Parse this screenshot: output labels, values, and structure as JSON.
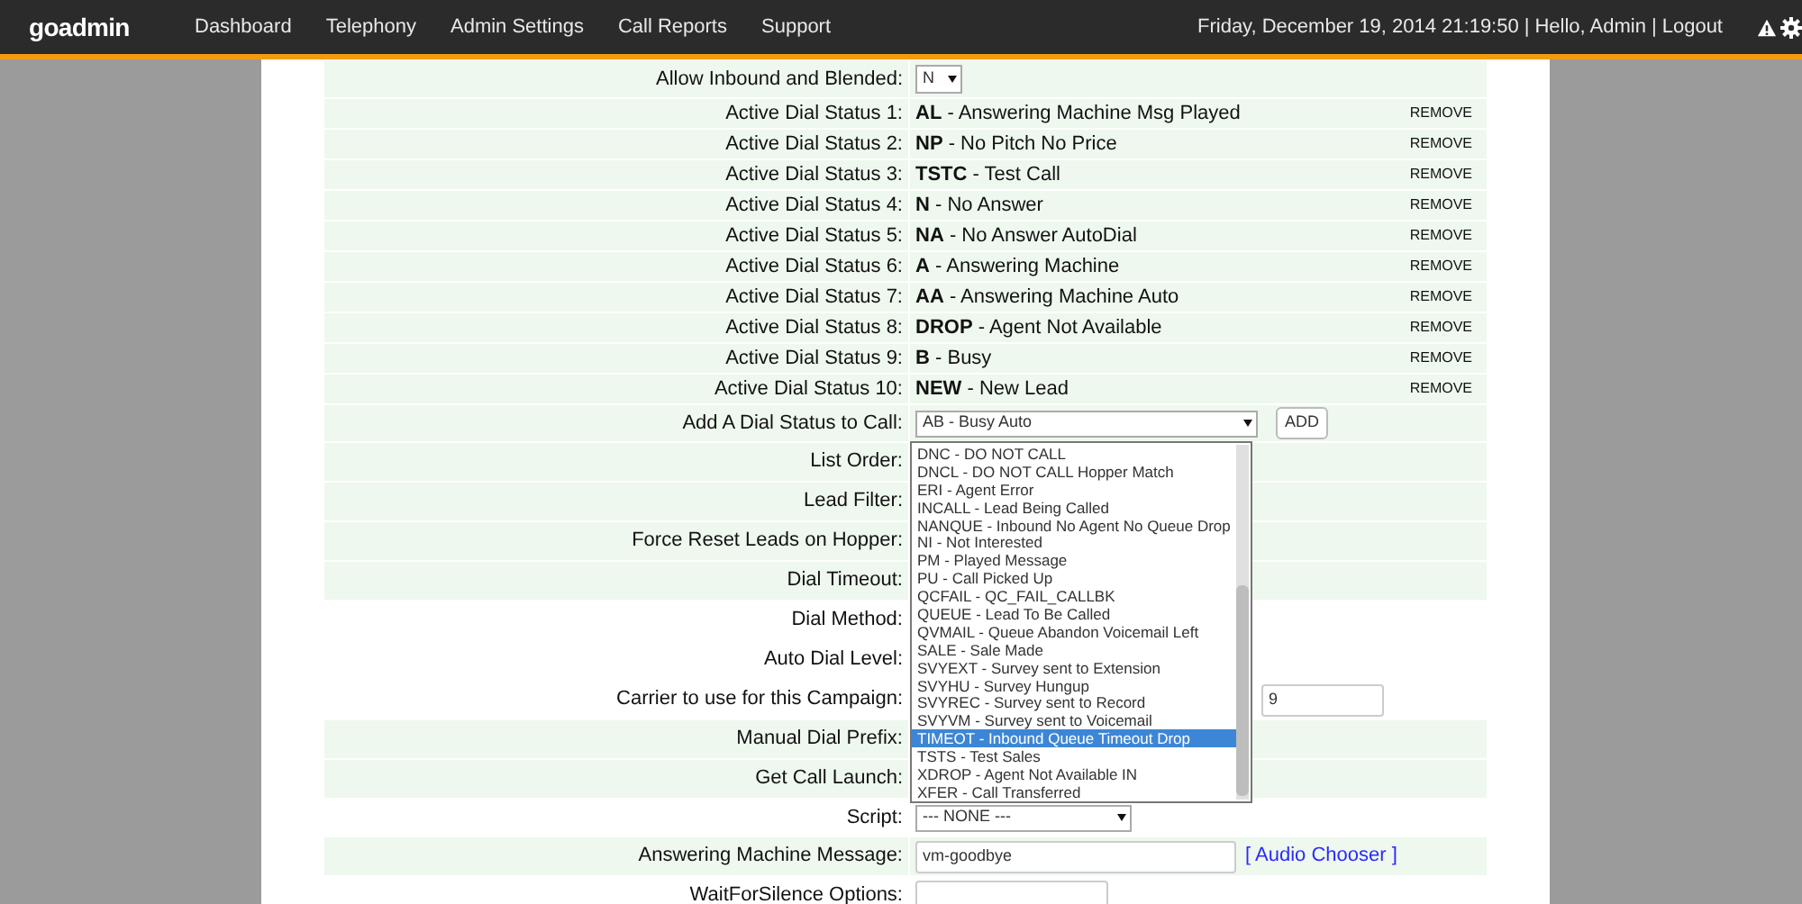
{
  "nav": {
    "logo": "goadmin",
    "menu": [
      "Dashboard",
      "Telephony",
      "Admin Settings",
      "Call Reports",
      "Support"
    ],
    "datetime": "Friday, December 19, 2014 21:19:50",
    "separator_1": "|",
    "greeting": "Hello, Admin",
    "separator_2": "|",
    "logout": "Logout"
  },
  "form": {
    "rows": [
      {
        "kind": "select",
        "label": "Allow Inbound and Blended:",
        "value": "N",
        "shaded": true
      },
      {
        "kind": "status",
        "label": "Active Dial Status 1:",
        "status": "**AL** - Answering Machine Msg Played",
        "action": "REMOVE",
        "shaded": true
      },
      {
        "kind": "status",
        "label": "Active Dial Status 2:",
        "status": "**NP** - No Pitch No Price",
        "action": "REMOVE",
        "shaded": true
      },
      {
        "kind": "status",
        "label": "Active Dial Status 3:",
        "status": "**TSTC** - Test Call",
        "action": "REMOVE",
        "shaded": true
      },
      {
        "kind": "status",
        "label": "Active Dial Status 4:",
        "status": "**N** - No Answer",
        "action": "REMOVE",
        "shaded": true
      },
      {
        "kind": "status",
        "label": "Active Dial Status 5:",
        "status": "**NA** - No Answer AutoDial",
        "action": "REMOVE",
        "shaded": true
      },
      {
        "kind": "status",
        "label": "Active Dial Status 6:",
        "status": "**A** - Answering Machine",
        "action": "REMOVE",
        "shaded": true
      },
      {
        "kind": "status",
        "label": "Active Dial Status 7:",
        "status": "**AA** - Answering Machine Auto",
        "action": "REMOVE",
        "shaded": true
      },
      {
        "kind": "status",
        "label": "Active Dial Status 8:",
        "status": "**DROP** - Agent Not Available",
        "action": "REMOVE",
        "shaded": true
      },
      {
        "kind": "status",
        "label": "Active Dial Status 9:",
        "status": "**B** - Busy",
        "action": "REMOVE",
        "shaded": true
      },
      {
        "kind": "status",
        "label": "Active Dial Status 10:",
        "status": "**NEW** - New Lead",
        "action": "REMOVE",
        "shaded": true
      },
      {
        "kind": "add",
        "label": "Add A Dial Status to Call:",
        "value": "AB - Busy Auto",
        "button": "ADD",
        "shaded": true
      },
      {
        "kind": "blank",
        "label": "List Order:",
        "shaded": true
      },
      {
        "kind": "blank",
        "label": "Lead Filter:",
        "shaded": true
      },
      {
        "kind": "blank",
        "label": "Force Reset Leads on Hopper:",
        "shaded": true
      },
      {
        "kind": "blank",
        "label": "Dial Timeout:",
        "shaded": true
      },
      {
        "kind": "blank",
        "label": "Dial Method:",
        "shaded": false
      },
      {
        "kind": "blank",
        "label": "Auto Dial Level:",
        "shaded": false
      },
      {
        "kind": "carrier",
        "label": "Carrier to use for this Campaign:",
        "value": "9",
        "shaded": false
      },
      {
        "kind": "blank",
        "label": "Manual Dial Prefix:",
        "shaded": true
      },
      {
        "kind": "blank",
        "label": "Get Call Launch:",
        "shaded": true
      },
      {
        "kind": "select",
        "label": "Script:",
        "value": "--- NONE ---",
        "shaded": false
      },
      {
        "kind": "input_link",
        "label": "Answering Machine Message:",
        "value": "vm-goodbye",
        "link": "[ Audio Chooser ]",
        "shaded": true
      },
      {
        "kind": "input",
        "label": "WaitForSilence Options:",
        "shaded": false
      }
    ]
  },
  "dropdown": {
    "options": [
      {
        "label": "DNC - DO NOT CALL",
        "selected": false
      },
      {
        "label": "DNCL - DO NOT CALL Hopper Match",
        "selected": false
      },
      {
        "label": "ERI - Agent Error",
        "selected": false
      },
      {
        "label": "INCALL - Lead Being Called",
        "selected": false
      },
      {
        "label": "NANQUE - Inbound No Agent No Queue Drop",
        "selected": false
      },
      {
        "label": "NI - Not Interested",
        "selected": false
      },
      {
        "label": "PM - Played Message",
        "selected": false
      },
      {
        "label": "PU - Call Picked Up",
        "selected": false
      },
      {
        "label": "QCFAIL - QC_FAIL_CALLBK",
        "selected": false
      },
      {
        "label": "QUEUE - Lead To Be Called",
        "selected": false
      },
      {
        "label": "QVMAIL - Queue Abandon Voicemail Left",
        "selected": false
      },
      {
        "label": "SALE - Sale Made",
        "selected": false
      },
      {
        "label": "SVYEXT - Survey sent to Extension",
        "selected": false
      },
      {
        "label": "SVYHU - Survey Hungup",
        "selected": false
      },
      {
        "label": "SVYREC - Survey sent to Record",
        "selected": false
      },
      {
        "label": "SVYVM - Survey sent to Voicemail",
        "selected": false
      },
      {
        "label": "TIMEOT - Inbound Queue Timeout Drop",
        "selected": true
      },
      {
        "label": "TSTS - Test Sales",
        "selected": false
      },
      {
        "label": "XDROP - Agent Not Available IN",
        "selected": false
      },
      {
        "label": "XFER - Call Transferred",
        "selected": false
      }
    ]
  }
}
